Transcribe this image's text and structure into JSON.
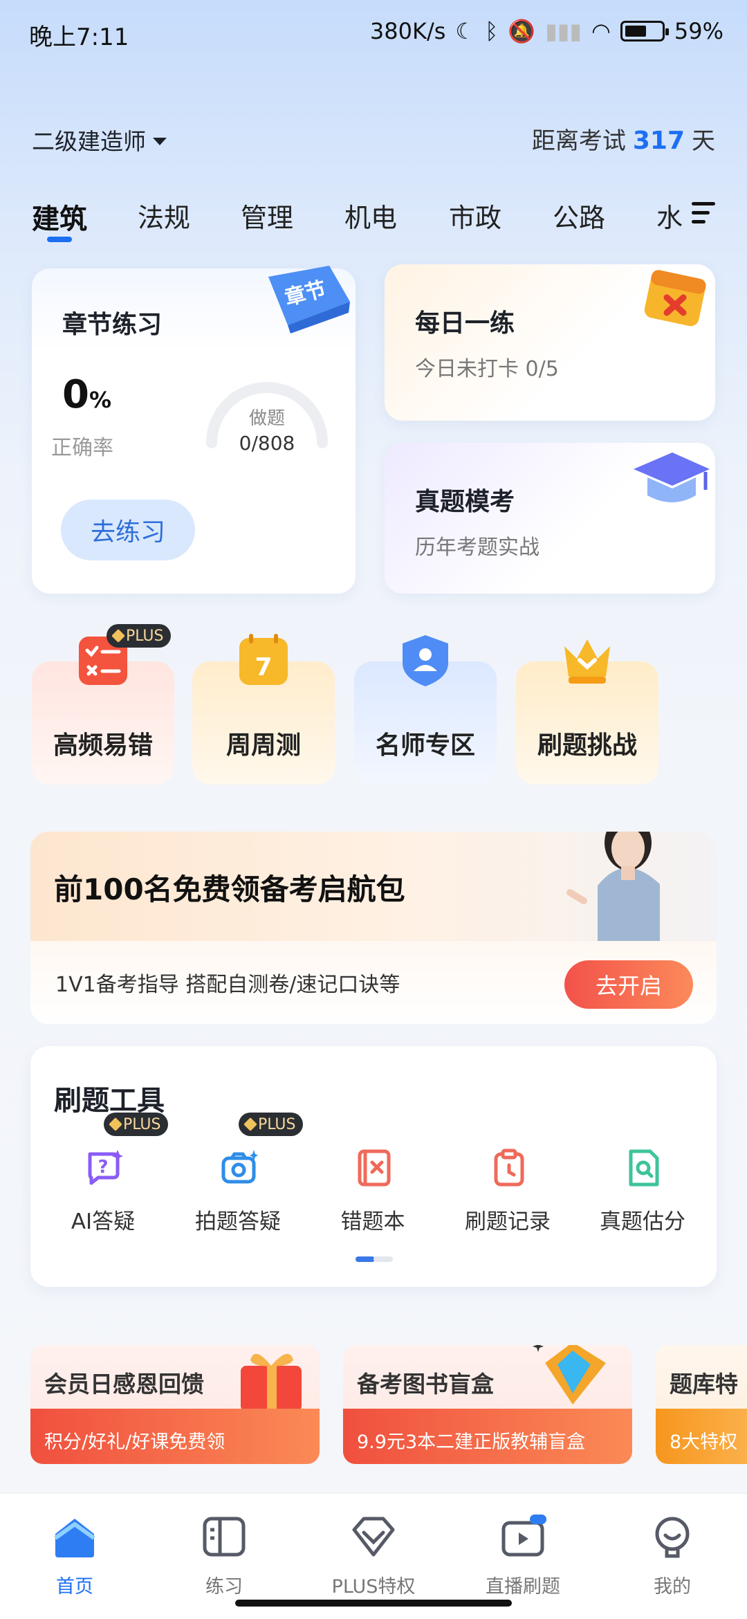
{
  "status_bar": {
    "time": "晚上7:11",
    "speed": "380K/s",
    "battery": "59%"
  },
  "header": {
    "exam_type": "二级建造师",
    "countdown_prefix": "距离考试",
    "countdown_days": "317",
    "countdown_unit": "天"
  },
  "subject_tabs": [
    {
      "label": "建筑",
      "active": true
    },
    {
      "label": "法规"
    },
    {
      "label": "管理"
    },
    {
      "label": "机电"
    },
    {
      "label": "市政"
    },
    {
      "label": "公路"
    },
    {
      "label": "水"
    }
  ],
  "chapter_card": {
    "title": "章节练习",
    "tag": "章节",
    "accuracy_value": "0",
    "accuracy_unit": "%",
    "accuracy_label": "正确率",
    "done_label": "做题",
    "done_value": "0/808",
    "done_progress": 0,
    "button": "去练习"
  },
  "daily_card": {
    "title": "每日一练",
    "subtitle": "今日未打卡 0/5"
  },
  "mock_card": {
    "title": "真题模考",
    "subtitle": "历年考题实战"
  },
  "features": [
    {
      "label": "高频易错",
      "icon": "checklist-icon",
      "badge": "PLUS",
      "color": "#f4533d"
    },
    {
      "label": "周周测",
      "icon": "calendar-icon",
      "icon_text": "7",
      "color": "#f7b829"
    },
    {
      "label": "名师专区",
      "icon": "teacher-shield-icon",
      "color": "#4f8cf6"
    },
    {
      "label": "刷题挑战",
      "icon": "crown-icon",
      "color": "#f7b829"
    }
  ],
  "promo": {
    "title": "前100名免费领备考启航包",
    "subtitle": "1V1备考指导 搭配自测卷/速记口诀等",
    "button": "去开启"
  },
  "tools": {
    "title": "刷题工具",
    "items": [
      {
        "label": "AI答疑",
        "icon": "ai-question-icon",
        "badge": "PLUS",
        "color": "#8a5cf5"
      },
      {
        "label": "拍题答疑",
        "icon": "camera-icon",
        "badge": "PLUS",
        "color": "#2f8de8"
      },
      {
        "label": "错题本",
        "icon": "wrong-book-icon",
        "color": "#ee6a5a"
      },
      {
        "label": "刷题记录",
        "icon": "clipboard-clock-icon",
        "color": "#ee6a5a"
      },
      {
        "label": "真题估分",
        "icon": "search-doc-icon",
        "color": "#3ec39b"
      }
    ]
  },
  "banners": [
    {
      "title": "会员日感恩回馈",
      "subtitle": "积分/好礼/好课免费领"
    },
    {
      "title": "备考图书盲盒",
      "subtitle": "9.9元3本二建正版教辅盲盒"
    },
    {
      "title": "题库特",
      "subtitle": "8大特权"
    }
  ],
  "bottom_nav": [
    {
      "label": "首页",
      "icon": "home-icon",
      "active": true
    },
    {
      "label": "练习",
      "icon": "practice-icon"
    },
    {
      "label": "PLUS特权",
      "icon": "diamond-icon"
    },
    {
      "label": "直播刷题",
      "icon": "live-play-icon"
    },
    {
      "label": "我的",
      "icon": "profile-icon"
    }
  ]
}
